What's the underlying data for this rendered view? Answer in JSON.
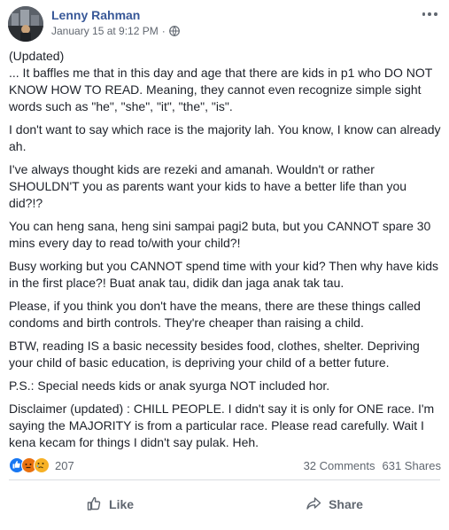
{
  "post": {
    "author": "Lenny Rahman",
    "timestamp": "January 15 at 9:12 PM",
    "separator": "·",
    "privacy_icon": "globe-icon",
    "paragraphs": [
      "(Updated)",
      "... It baffles me that in this day and age that there are kids in p1 who DO NOT KNOW HOW TO READ. Meaning, they cannot even recognize simple sight words such as \"he\", \"she\", \"it\", \"the\", \"is\".",
      "I don't want to say which race is the majority lah. You know, I know can already ah.",
      "I've always thought kids are rezeki and amanah. Wouldn't or rather SHOULDN'T you as parents want your kids to have a better life than you did?!?",
      "You can heng sana, heng sini sampai pagi2 buta, but you CANNOT spare 30 mins every day to read to/with your child?!",
      "Busy working but you CANNOT spend time with your kid? Then why have kids in the first place?! Buat anak tau, didik dan jaga anak tak tau.",
      "Please, if you think you don't have the means, there are these things called condoms and birth controls. They're cheaper than raising a child.",
      "BTW, reading IS a basic necessity besides food, clothes, shelter. Depriving your child of basic education, is depriving your child of a better future.",
      "P.S.: Special needs kids or anak syurga NOT included hor.",
      "Disclaimer (updated) : CHILL PEOPLE. I didn't say it is only for ONE race. I'm saying the MAJORITY is from a particular race. Please read carefully. Wait I kena kecam for things I didn't say pulak. Heh."
    ]
  },
  "reactions": {
    "icons": [
      "like-icon",
      "angry-icon",
      "sad-icon"
    ],
    "count": "207"
  },
  "stats": {
    "comments": "32 Comments",
    "shares": "631 Shares"
  },
  "actions": {
    "like_label": "Like",
    "share_label": "Share"
  },
  "colors": {
    "author": "#385898",
    "text": "#1d2129",
    "meta": "#616770",
    "like_blue": "#1877f2"
  }
}
